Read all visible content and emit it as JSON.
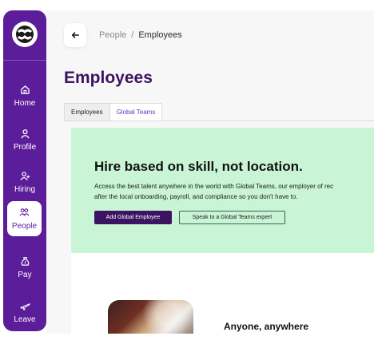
{
  "colors": {
    "sidebar_bg": "#5c1d9a",
    "title": "#3b1361",
    "hero_bg": "#c9f5d6",
    "primary_button": "#3b1361",
    "tab_accent": "#6a33c2"
  },
  "sidebar": {
    "logo_icon": "global-teams-logo",
    "items": [
      {
        "label": "Home",
        "icon": "home-icon",
        "active": false
      },
      {
        "label": "Profile",
        "icon": "user-icon",
        "active": false
      },
      {
        "label": "Hiring",
        "icon": "user-add-icon",
        "active": false
      },
      {
        "label": "People",
        "icon": "people-icon",
        "active": true
      },
      {
        "label": "Pay",
        "icon": "money-bag-icon",
        "active": false
      },
      {
        "label": "Leave",
        "icon": "airplane-icon",
        "active": false
      }
    ]
  },
  "header": {
    "back_icon": "arrow-left-icon",
    "breadcrumb": [
      "People",
      "Employees"
    ],
    "separator": "/"
  },
  "page": {
    "title": "Employees",
    "tabs": [
      "Employees",
      "Global Teams"
    ]
  },
  "hero": {
    "title": "Hire based on skill, not location.",
    "text_line1": "Access the best talent anywhere in the world with Global Teams, our employer of rec",
    "text_line2": "after the local onboarding, payroll, and compliance so you don't have to.",
    "primary_button": "Add Global Employee",
    "secondary_button": "Speak to a Global Teams expert"
  },
  "feature": {
    "title": "Anyone, anywhere"
  }
}
